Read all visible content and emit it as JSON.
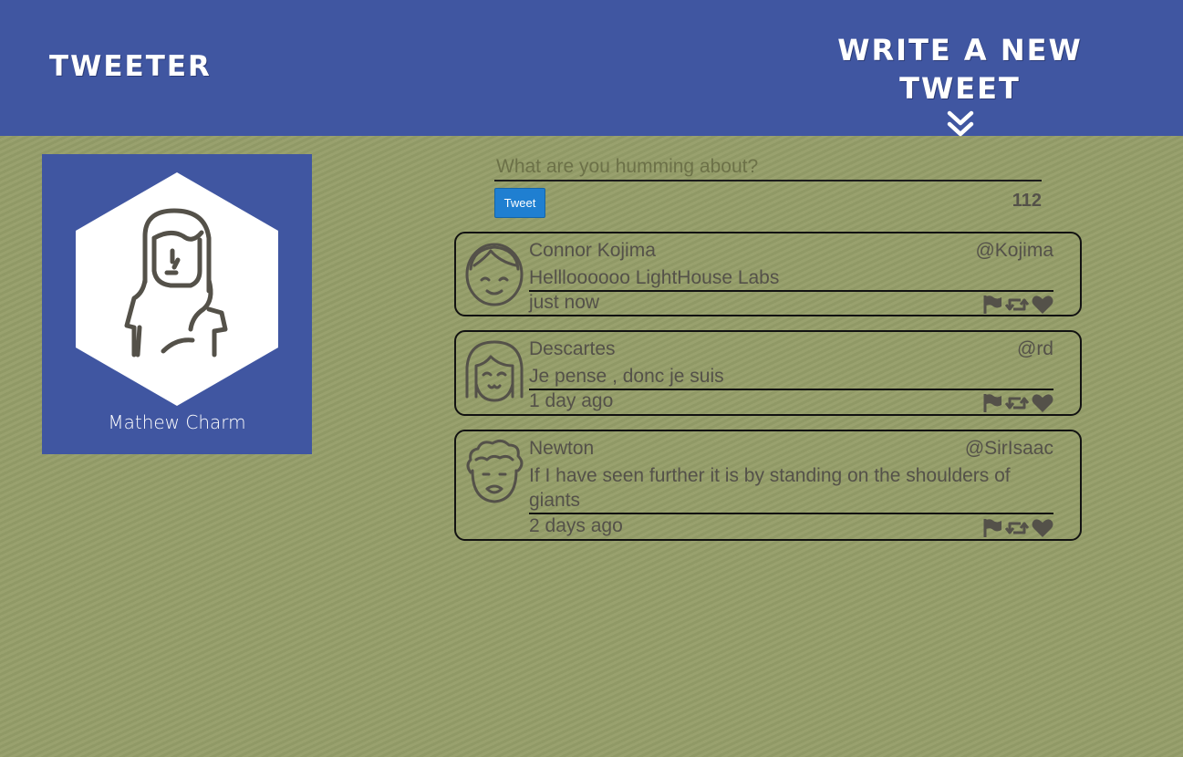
{
  "nav": {
    "brand": "Tweeter",
    "compose_label": "Write a new tweet"
  },
  "profile": {
    "name": "Mathew Charm"
  },
  "composer": {
    "placeholder": "What are you humming about?",
    "button_label": "Tweet",
    "counter": "112"
  },
  "tweets": [
    {
      "name": "Connor Kojima",
      "handle": "@Kojima",
      "text": "Hellloooooo LightHouse Labs",
      "time": "just now",
      "avatar": "smiling-boy-avatar"
    },
    {
      "name": "Descartes",
      "handle": "@rd",
      "text": "Je pense , donc je suis",
      "time": "1 day ago",
      "avatar": "bob-haircut-avatar"
    },
    {
      "name": "Newton",
      "handle": "@SirIsaac",
      "text": "If I have seen further it is by standing on the shoulders of giants",
      "time": "2 days ago",
      "avatar": "curly-hair-avatar"
    }
  ],
  "icons": {
    "actions": [
      "flag-icon",
      "retweet-icon",
      "heart-icon"
    ]
  },
  "colors": {
    "nav_bg": "#4056a1",
    "page_bg": "#959e69",
    "button": "#1f7fd1",
    "text": "#545149"
  }
}
